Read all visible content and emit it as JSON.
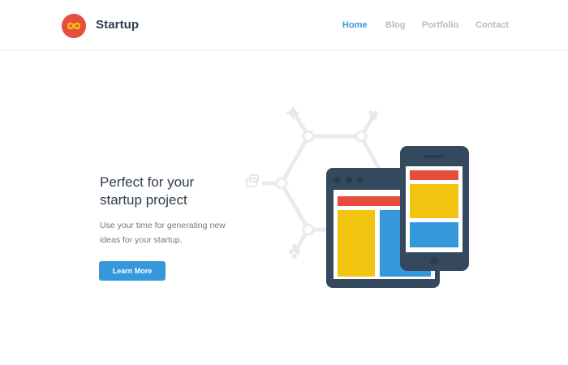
{
  "brand": {
    "name": "Startup",
    "logo_icon": "infinity-icon",
    "logo_colors": {
      "circle": "#e74c3c",
      "symbol": "#f1c40f"
    }
  },
  "nav": {
    "items": [
      {
        "label": "Home",
        "active": true
      },
      {
        "label": "Blog",
        "active": false
      },
      {
        "label": "Portfolio",
        "active": false
      },
      {
        "label": "Contact",
        "active": false
      }
    ]
  },
  "hero": {
    "title_lines": [
      "Perfect for your",
      "startup project"
    ],
    "description_lines": [
      "Use your time for generating new",
      "ideas for your startup."
    ],
    "cta_label": "Learn More"
  },
  "illustration": {
    "type": "devices-illustration",
    "icons": [
      "gear-icon",
      "bee-icon",
      "screen-icon",
      "network-icon"
    ],
    "colors": {
      "device": "#34495e",
      "red": "#e74c3c",
      "yellow": "#f1c40f",
      "blue": "#3498db",
      "network": "#e9ebed"
    }
  },
  "colors": {
    "accent": "#3498db",
    "text_dark": "#2f3d4c",
    "text_muted": "#b6bcc2"
  }
}
